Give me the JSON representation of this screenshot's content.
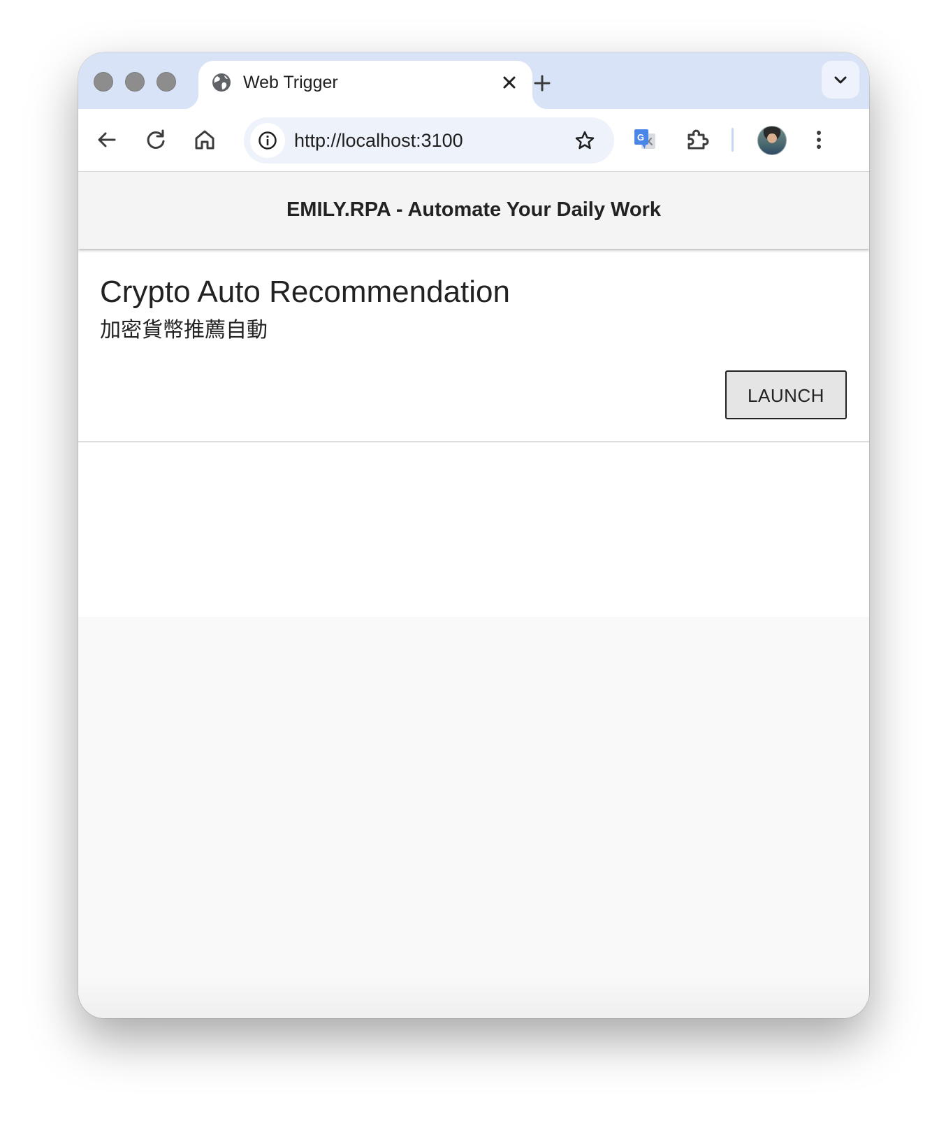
{
  "browser": {
    "tab_title": "Web Trigger",
    "url": "http://localhost:3100"
  },
  "app": {
    "header_title": "EMILY.RPA - Automate Your Daily Work"
  },
  "card": {
    "title": "Crypto Auto Recommendation",
    "subtitle": "加密貨幣推薦自動",
    "launch_label": "LAUNCH"
  },
  "colors": {
    "tabstrip": "#d9e3f8",
    "appbar": "#f4f4f4",
    "button_bg": "#e5e5e5"
  }
}
